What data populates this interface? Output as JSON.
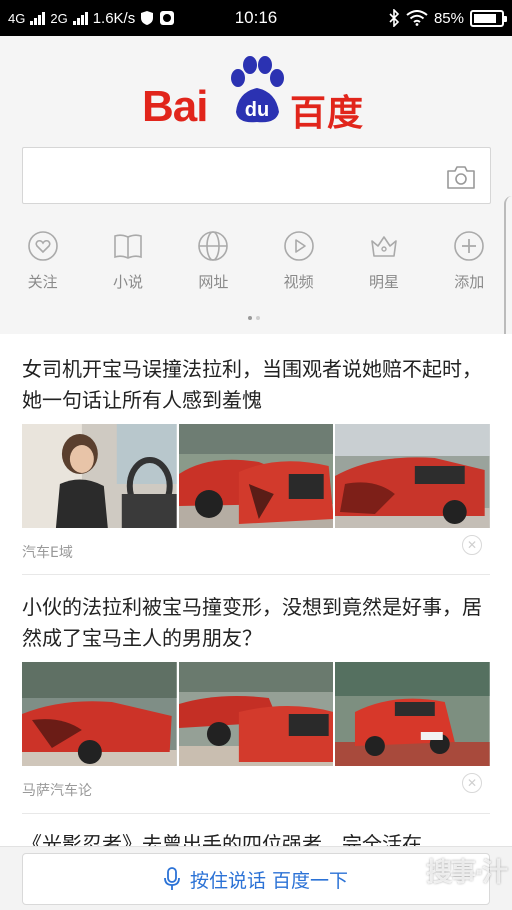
{
  "status_bar": {
    "network1": "4G",
    "network2": "2G",
    "speed": "1.6K/s",
    "time": "10:16",
    "battery": "85%",
    "battery_level": 0.85
  },
  "logo": {
    "text_en": "Bai",
    "paw_text": "du",
    "text_cn": "百度"
  },
  "search": {
    "value": "",
    "placeholder": "",
    "camera_icon": "camera-icon"
  },
  "nav": [
    {
      "label": "关注",
      "icon": "heart-icon"
    },
    {
      "label": "小说",
      "icon": "book-icon"
    },
    {
      "label": "网址",
      "icon": "globe-icon"
    },
    {
      "label": "视频",
      "icon": "play-icon"
    },
    {
      "label": "明星",
      "icon": "crown-icon"
    },
    {
      "label": "添加",
      "icon": "plus-icon"
    }
  ],
  "feed": [
    {
      "title": "女司机开宝马误撞法拉利，当围观者说她赔不起时，她一句话让所有人感到羞愧",
      "source": "汽车E域"
    },
    {
      "title": "小伙的法拉利被宝马撞变形，没想到竟然是好事，居然成了宝马主人的男朋友？",
      "source": "马萨汽车论"
    },
    {
      "title": "《光影忍者》去曾出手的四位强者，完全活在"
    }
  ],
  "bottom": {
    "voice_label": "按住说话 百度一下",
    "watermark": "搜事·汁"
  },
  "colors": {
    "brand_red": "#e1251b",
    "brand_blue": "#2b32b2",
    "link_blue": "#2b72d6"
  }
}
